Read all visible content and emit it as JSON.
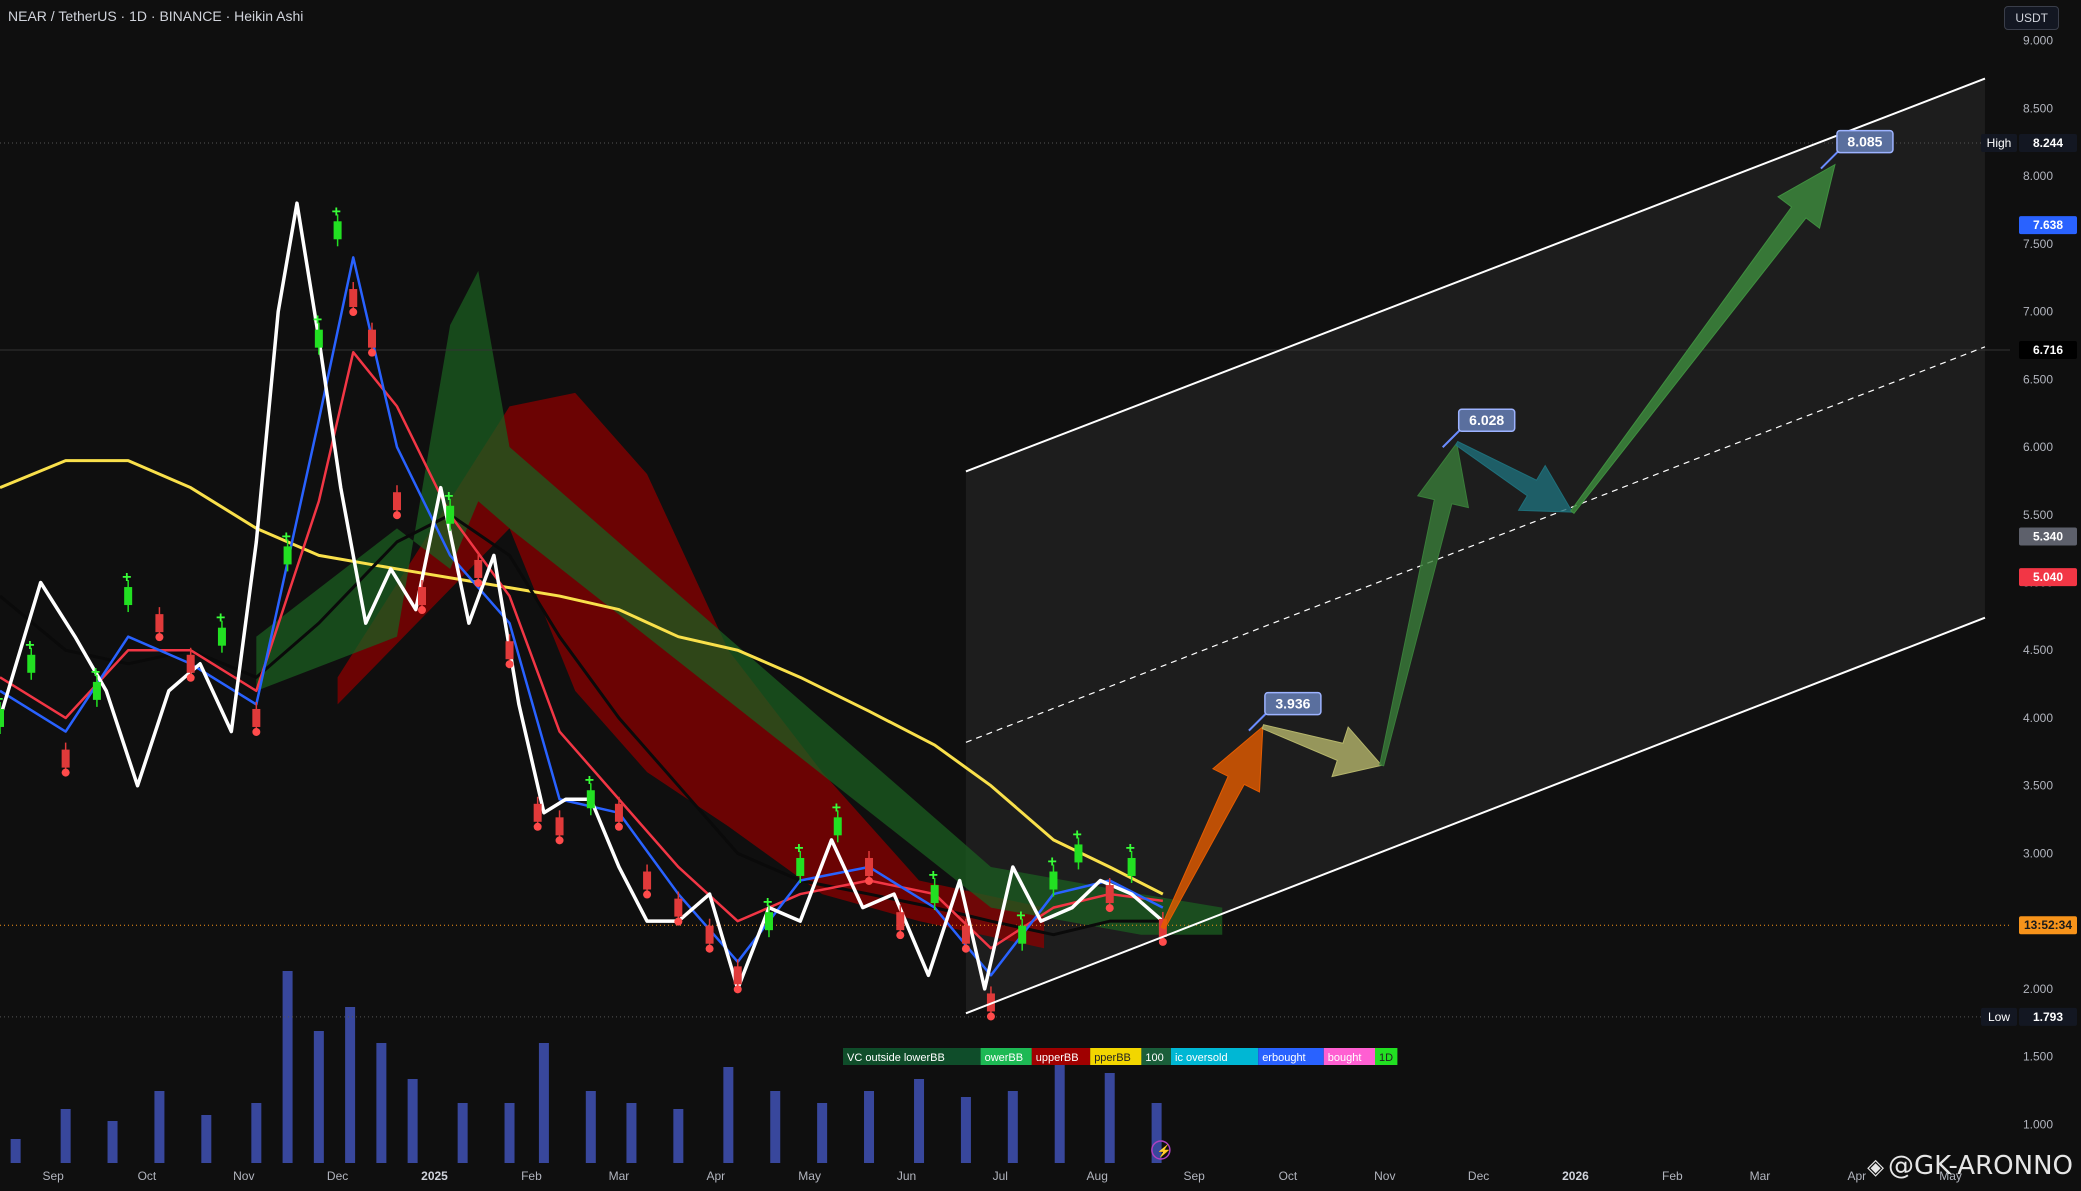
{
  "header": {
    "title": "NEAR / TetherUS · 1D · BINANCE · Heikin Ashi",
    "currency": "USDT"
  },
  "watermark": "@GK-ARONNO",
  "colors": {
    "background": "#0f0f0f",
    "ema_fast": "#2962ff",
    "ema_mid": "#f23645",
    "ema_slow": "#000000",
    "sma_long": "#f9e04b",
    "rsi_line": "#ffffff",
    "cloud_bull": "#1b5e20",
    "cloud_bear": "#8b0000",
    "volume": "#3f51b5",
    "channel": "#ffffff",
    "arrow_orange": "#e65c00",
    "arrow_khaki": "#b5b56b",
    "arrow_green": "#3a7d3a",
    "arrow_teal": "#1f6f7a",
    "arrow_bright_green": "#3f8f3f"
  },
  "chart_data": {
    "type": "line",
    "symbol": "NEAR / TetherUS",
    "timeframe": "1D",
    "exchange": "BINANCE",
    "candle_type": "Heikin Ashi",
    "ylim": [
      0.7,
      9.3
    ],
    "x_ticks": [
      "Sep",
      "Oct",
      "Nov",
      "Dec",
      "2025",
      "Feb",
      "Mar",
      "Apr",
      "May",
      "Jun",
      "Jul",
      "Aug",
      "Sep",
      "Oct",
      "Nov",
      "Dec",
      "2026",
      "Feb",
      "Mar",
      "Apr",
      "May"
    ],
    "x_tick_dates": [
      "2024-09-01",
      "2024-10-01",
      "2024-11-01",
      "2024-12-01",
      "2025-01-01",
      "2025-02-01",
      "2025-03-01",
      "2025-04-01",
      "2025-05-01",
      "2025-06-01",
      "2025-07-01",
      "2025-08-01",
      "2025-09-01",
      "2025-10-01",
      "2025-11-01",
      "2025-12-01",
      "2026-01-01",
      "2026-02-01",
      "2026-03-01",
      "2026-04-01",
      "2026-05-01"
    ],
    "y_ticks": [
      "9.000",
      "8.500",
      "8.000",
      "7.500",
      "7.000",
      "6.500",
      "6.000",
      "5.500",
      "5.000",
      "4.500",
      "4.000",
      "3.500",
      "3.000",
      "2.500",
      "2.000",
      "1.500",
      "1.000"
    ],
    "y_tick_values": [
      9.0,
      8.5,
      8.0,
      7.5,
      7.0,
      6.5,
      6.0,
      5.5,
      5.0,
      4.5,
      4.0,
      3.5,
      3.0,
      2.5,
      2.0,
      1.5,
      1.0
    ],
    "price_labels": [
      {
        "label": "High",
        "text": "8.244",
        "value": 8.244,
        "color": "#131722"
      },
      {
        "label": "",
        "text": "7.638",
        "value": 7.638,
        "color": "#2962ff"
      },
      {
        "label": "",
        "text": "6.716",
        "value": 6.716,
        "color": "#000000"
      },
      {
        "label": "",
        "text": "5.340",
        "value": 5.34,
        "color": "#5d606b"
      },
      {
        "label": "",
        "text": "5.040",
        "value": 5.04,
        "color": "#f23645"
      },
      {
        "label": "",
        "text": "13:52:34",
        "value": 2.47,
        "color": "#f7931a"
      },
      {
        "label": "Low",
        "text": "1.793",
        "value": 1.793,
        "color": "#131722"
      }
    ],
    "targets": [
      {
        "text": "3.936",
        "date": "2025-09-23",
        "value": 3.936
      },
      {
        "text": "6.028",
        "date": "2025-11-24",
        "value": 6.028
      },
      {
        "text": "8.085",
        "date": "2026-03-25",
        "value": 8.085
      }
    ],
    "channel": {
      "upper": [
        {
          "date": "2025-06-20",
          "value": 5.82
        },
        {
          "date": "2026-05-12",
          "value": 8.72
        }
      ],
      "middle": [
        {
          "date": "2025-06-20",
          "value": 3.82
        },
        {
          "date": "2026-05-12",
          "value": 6.74
        }
      ],
      "lower": [
        {
          "date": "2025-06-20",
          "value": 1.82
        },
        {
          "date": "2026-05-12",
          "value": 4.74
        }
      ]
    },
    "projection_path": [
      {
        "date": "2025-08-22",
        "value": 2.45
      },
      {
        "date": "2025-09-23",
        "value": 3.936
      },
      {
        "date": "2025-10-31",
        "value": 3.65
      },
      {
        "date": "2025-11-24",
        "value": 6.028
      },
      {
        "date": "2025-12-31",
        "value": 5.52
      },
      {
        "date": "2026-03-25",
        "value": 8.085
      }
    ],
    "series": [
      {
        "name": "",
        "style": "heikin_ashi_close",
        "x": [
          "2024-08-15",
          "2024-08-25",
          "2024-09-05",
          "2024-09-15",
          "2024-09-25",
          "2024-10-05",
          "2024-10-15",
          "2024-10-25",
          "2024-11-05",
          "2024-11-15",
          "2024-11-25",
          "2024-12-01",
          "2024-12-06",
          "2024-12-12",
          "2024-12-20",
          "2024-12-28",
          "2025-01-06",
          "2025-01-15",
          "2025-01-25",
          "2025-02-03",
          "2025-02-10",
          "2025-02-20",
          "2025-03-01",
          "2025-03-10",
          "2025-03-20",
          "2025-03-30",
          "2025-04-08",
          "2025-04-18",
          "2025-04-28",
          "2025-05-10",
          "2025-05-20",
          "2025-05-30",
          "2025-06-10",
          "2025-06-20",
          "2025-06-28",
          "2025-07-08",
          "2025-07-18",
          "2025-07-26",
          "2025-08-05",
          "2025-08-12",
          "2025-08-22"
        ],
        "y": [
          4.0,
          4.4,
          3.7,
          4.2,
          4.9,
          4.7,
          4.4,
          4.6,
          4.0,
          5.2,
          6.8,
          7.6,
          7.1,
          6.8,
          5.6,
          4.9,
          5.5,
          5.1,
          4.5,
          3.3,
          3.2,
          3.4,
          3.3,
          2.8,
          2.6,
          2.4,
          2.1,
          2.5,
          2.9,
          3.2,
          2.9,
          2.5,
          2.7,
          2.4,
          1.9,
          2.4,
          2.8,
          3.0,
          2.7,
          2.9,
          2.45
        ]
      },
      {
        "name": "",
        "style": "ema_fast",
        "x": [
          "2024-08-15",
          "2024-09-05",
          "2024-09-25",
          "2024-10-15",
          "2024-11-05",
          "2024-11-25",
          "2024-12-06",
          "2024-12-20",
          "2025-01-06",
          "2025-01-25",
          "2025-02-10",
          "2025-03-01",
          "2025-03-20",
          "2025-04-08",
          "2025-04-28",
          "2025-05-20",
          "2025-06-10",
          "2025-06-28",
          "2025-07-18",
          "2025-08-05",
          "2025-08-22"
        ],
        "y": [
          4.2,
          3.9,
          4.6,
          4.4,
          4.1,
          6.2,
          7.4,
          6.0,
          5.2,
          4.7,
          3.4,
          3.3,
          2.7,
          2.2,
          2.8,
          2.9,
          2.6,
          2.1,
          2.7,
          2.8,
          2.6
        ]
      },
      {
        "name": "",
        "style": "ema_mid",
        "x": [
          "2024-08-15",
          "2024-09-05",
          "2024-09-25",
          "2024-10-15",
          "2024-11-05",
          "2024-11-25",
          "2024-12-06",
          "2024-12-20",
          "2025-01-06",
          "2025-01-25",
          "2025-02-10",
          "2025-03-01",
          "2025-03-20",
          "2025-04-08",
          "2025-04-28",
          "2025-05-20",
          "2025-06-10",
          "2025-06-28",
          "2025-07-18",
          "2025-08-05",
          "2025-08-22"
        ],
        "y": [
          4.3,
          4.0,
          4.5,
          4.5,
          4.2,
          5.6,
          6.7,
          6.3,
          5.5,
          4.9,
          3.9,
          3.4,
          2.9,
          2.5,
          2.7,
          2.8,
          2.7,
          2.3,
          2.6,
          2.7,
          2.65
        ]
      },
      {
        "name": "",
        "style": "ema_slow",
        "x": [
          "2024-08-15",
          "2024-09-05",
          "2024-09-25",
          "2024-10-15",
          "2024-11-05",
          "2024-11-25",
          "2024-12-20",
          "2025-01-06",
          "2025-01-25",
          "2025-02-10",
          "2025-03-01",
          "2025-03-20",
          "2025-04-08",
          "2025-04-28",
          "2025-05-20",
          "2025-06-10",
          "2025-06-28",
          "2025-07-18",
          "2025-08-05",
          "2025-08-22"
        ],
        "y": [
          4.9,
          4.5,
          4.4,
          4.5,
          4.3,
          4.7,
          5.3,
          5.5,
          5.2,
          4.6,
          4.0,
          3.5,
          3.0,
          2.8,
          2.7,
          2.6,
          2.5,
          2.4,
          2.5,
          2.5
        ]
      },
      {
        "name": "",
        "style": "sma_long",
        "x": [
          "2024-08-15",
          "2024-09-05",
          "2024-09-25",
          "2024-10-15",
          "2024-11-05",
          "2024-11-25",
          "2024-12-20",
          "2025-01-15",
          "2025-02-10",
          "2025-03-01",
          "2025-03-20",
          "2025-04-08",
          "2025-04-28",
          "2025-05-20",
          "2025-06-10",
          "2025-06-28",
          "2025-07-18",
          "2025-08-05",
          "2025-08-22"
        ],
        "y": [
          5.7,
          5.9,
          5.9,
          5.7,
          5.4,
          5.2,
          5.1,
          5.0,
          4.9,
          4.8,
          4.6,
          4.5,
          4.3,
          4.05,
          3.8,
          3.5,
          3.1,
          2.9,
          2.7
        ]
      },
      {
        "name": "",
        "style": "rsi_overlay",
        "x": [
          "2024-08-15",
          "2024-08-28",
          "2024-09-08",
          "2024-09-18",
          "2024-09-28",
          "2024-10-08",
          "2024-10-18",
          "2024-10-28",
          "2024-11-05",
          "2024-11-12",
          "2024-11-18",
          "2024-11-25",
          "2024-12-02",
          "2024-12-10",
          "2024-12-18",
          "2024-12-26",
          "2025-01-03",
          "2025-01-12",
          "2025-01-20",
          "2025-01-28",
          "2025-02-05",
          "2025-02-12",
          "2025-02-20",
          "2025-03-01",
          "2025-03-10",
          "2025-03-20",
          "2025-03-30",
          "2025-04-08",
          "2025-04-18",
          "2025-04-28",
          "2025-05-08",
          "2025-05-18",
          "2025-05-28",
          "2025-06-08",
          "2025-06-18",
          "2025-06-26",
          "2025-07-05",
          "2025-07-14",
          "2025-07-24",
          "2025-08-02",
          "2025-08-12",
          "2025-08-22"
        ],
        "y": [
          4.0,
          5.0,
          4.6,
          4.2,
          3.5,
          4.2,
          4.4,
          3.9,
          5.3,
          7.0,
          7.8,
          6.8,
          5.7,
          4.7,
          5.1,
          4.8,
          5.7,
          4.7,
          5.2,
          4.1,
          3.3,
          3.4,
          3.4,
          2.9,
          2.5,
          2.5,
          2.7,
          2.0,
          2.6,
          2.5,
          3.1,
          2.6,
          2.7,
          2.1,
          2.8,
          2.0,
          2.9,
          2.5,
          2.6,
          2.8,
          2.7,
          2.5
        ]
      },
      {
        "name": "",
        "style": "volume",
        "x": [
          "2024-08-20",
          "2024-09-05",
          "2024-09-20",
          "2024-10-05",
          "2024-10-20",
          "2024-11-05",
          "2024-11-15",
          "2024-11-25",
          "2024-12-05",
          "2024-12-15",
          "2024-12-25",
          "2025-01-10",
          "2025-01-25",
          "2025-02-05",
          "2025-02-20",
          "2025-03-05",
          "2025-03-20",
          "2025-04-05",
          "2025-04-20",
          "2025-05-05",
          "2025-05-20",
          "2025-06-05",
          "2025-06-20",
          "2025-07-05",
          "2025-07-20",
          "2025-08-05",
          "2025-08-20"
        ],
        "y": [
          0.2,
          0.45,
          0.35,
          0.6,
          0.4,
          0.5,
          1.6,
          1.1,
          1.3,
          1.0,
          0.7,
          0.5,
          0.5,
          1.0,
          0.6,
          0.5,
          0.45,
          0.8,
          0.6,
          0.5,
          0.6,
          0.7,
          0.55,
          0.6,
          0.9,
          0.75,
          0.5
        ]
      }
    ],
    "legend_labels": [
      "VC outside lowerBB",
      "owerBB",
      "upperBB",
      "pperBB",
      "100",
      "ic oversold",
      "erbought",
      "bought",
      "1D"
    ]
  }
}
